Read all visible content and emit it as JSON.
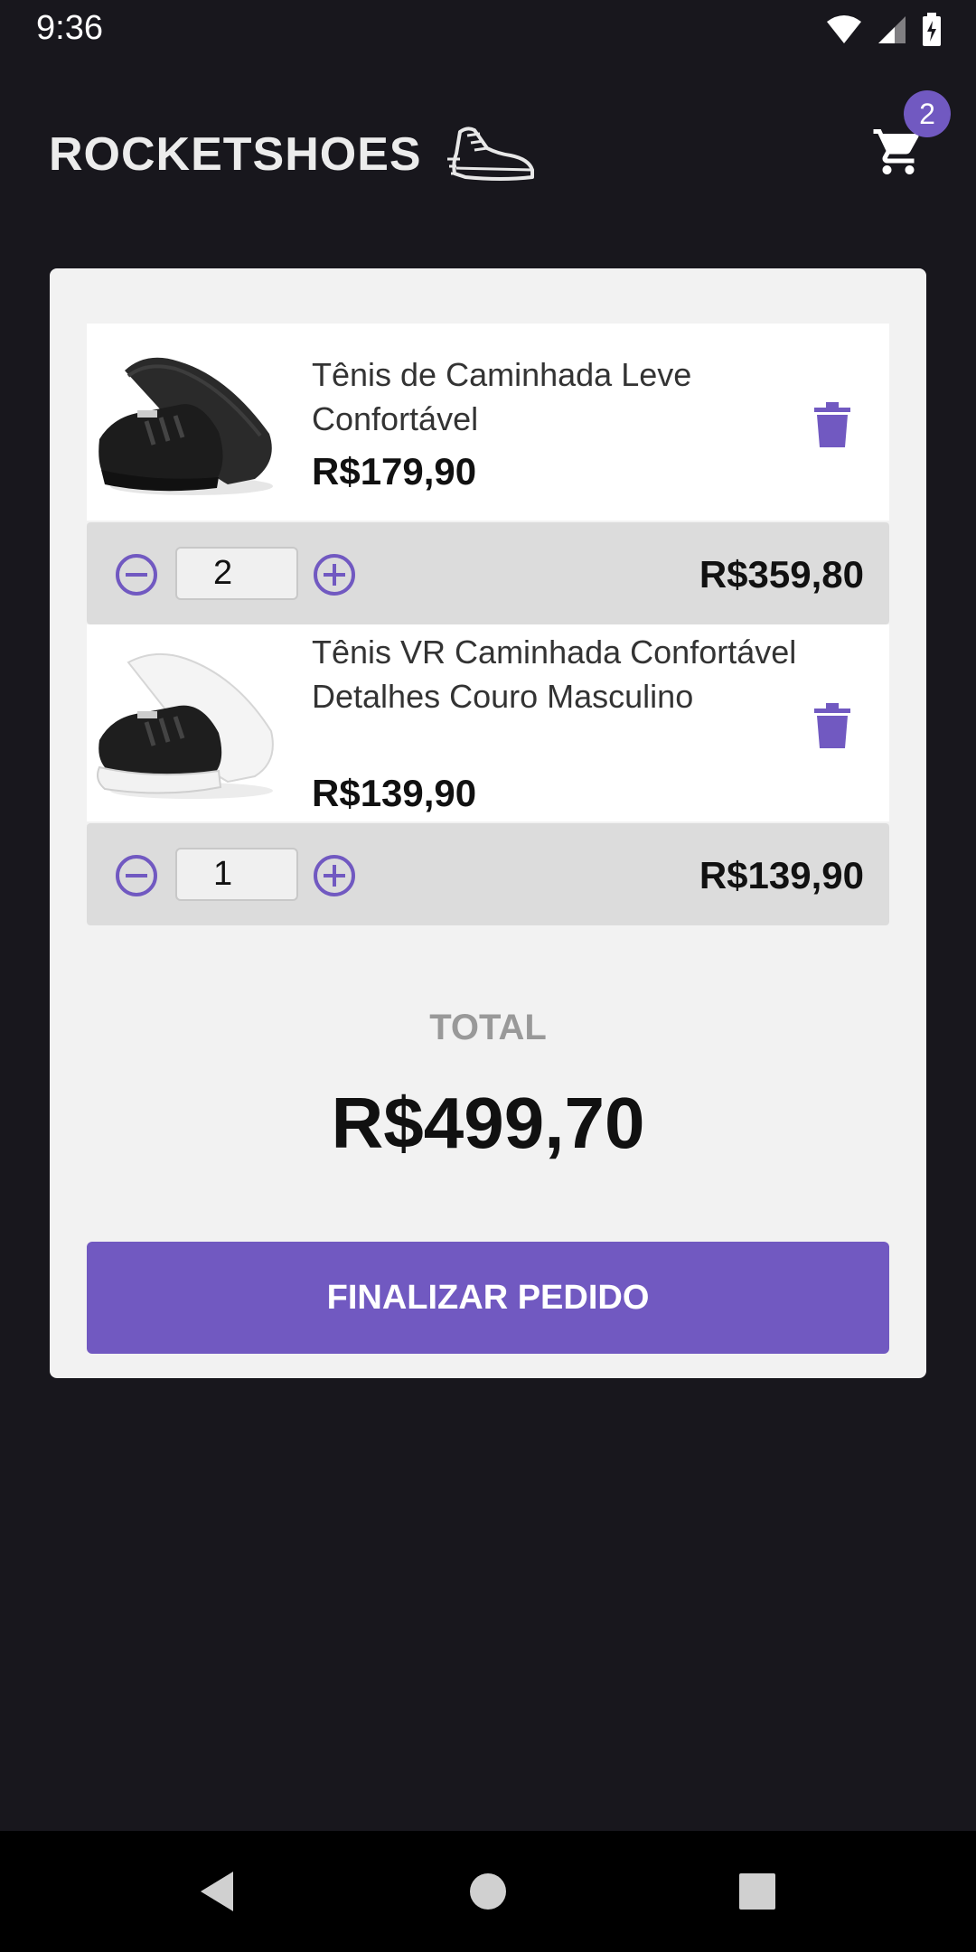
{
  "status_bar": {
    "time": "9:36"
  },
  "header": {
    "logo_text": "ROCKETSHOES",
    "cart_count": "2"
  },
  "cart": {
    "items": [
      {
        "title": "Tênis de Caminhada Leve Confortável",
        "price": "R$179,90",
        "quantity": "2",
        "subtotal": "R$359,80",
        "image_icon": "shoe-black-image"
      },
      {
        "title": "Tênis VR Caminhada Confortável Detalhes Couro Masculino",
        "price": "R$139,90",
        "quantity": "1",
        "subtotal": "R$139,90",
        "image_icon": "shoe-black-white-sole-image"
      }
    ],
    "total_label": "TOTAL",
    "total_value": "R$499,70",
    "checkout_label": "FINALIZAR PEDIDO"
  },
  "colors": {
    "background": "#18171d",
    "accent": "#7159c1",
    "card": "#f2f2f2",
    "qty_bar": "#dcdcdc"
  }
}
